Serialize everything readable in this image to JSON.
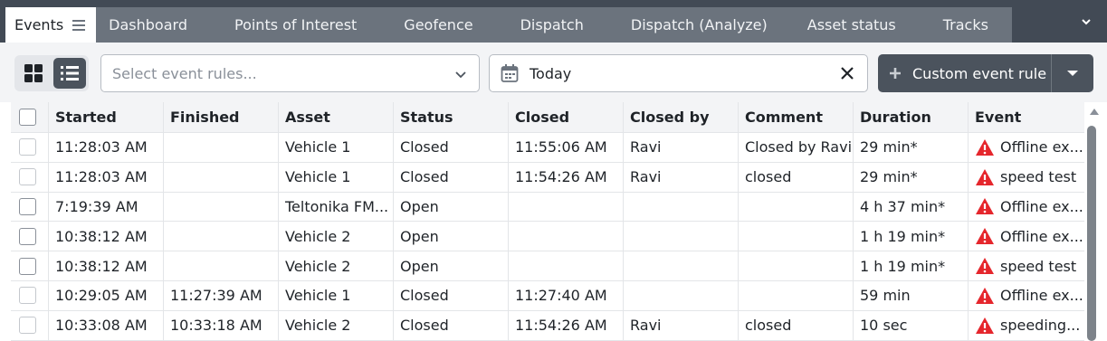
{
  "tabs": [
    {
      "label": "Events",
      "active": true
    },
    {
      "label": "Dashboard"
    },
    {
      "label": "Points of Interest"
    },
    {
      "label": "Geofence"
    },
    {
      "label": "Dispatch"
    },
    {
      "label": "Dispatch (Analyze)"
    },
    {
      "label": "Asset status"
    },
    {
      "label": "Tracks"
    }
  ],
  "toolbar": {
    "rules_placeholder": "Select event rules...",
    "date_value": "Today",
    "custom_rule_label": "Custom event rule"
  },
  "table": {
    "columns": [
      "Started",
      "Finished",
      "Asset",
      "Status",
      "Closed",
      "Closed by",
      "Comment",
      "Duration",
      "Event"
    ],
    "rows": [
      {
        "started": "11:28:03 AM",
        "finished": "",
        "asset": "Vehicle 1",
        "status": "Closed",
        "closed": "11:55:06 AM",
        "closed_by": "Ravi",
        "comment": "Closed by Ravi",
        "duration": "29 min*",
        "event": "Offline ex..."
      },
      {
        "started": "11:28:03 AM",
        "finished": "",
        "asset": "Vehicle 1",
        "status": "Closed",
        "closed": "11:54:26 AM",
        "closed_by": "Ravi",
        "comment": "closed",
        "duration": "29 min*",
        "event": "speed test"
      },
      {
        "started": "7:19:39 AM",
        "finished": "",
        "asset": "Teltonika FM...",
        "status": "Open",
        "closed": "",
        "closed_by": "",
        "comment": "",
        "duration": "4 h 37 min*",
        "event": "Offline ex..."
      },
      {
        "started": "10:38:12 AM",
        "finished": "",
        "asset": "Vehicle 2",
        "status": "Open",
        "closed": "",
        "closed_by": "",
        "comment": "",
        "duration": "1 h 19 min*",
        "event": "Offline ex..."
      },
      {
        "started": "10:38:12 AM",
        "finished": "",
        "asset": "Vehicle 2",
        "status": "Open",
        "closed": "",
        "closed_by": "",
        "comment": "",
        "duration": "1 h 19 min*",
        "event": "speed test"
      },
      {
        "started": "10:29:05 AM",
        "finished": "11:27:39 AM",
        "asset": "Vehicle 1",
        "status": "Closed",
        "closed": "11:27:40 AM",
        "closed_by": "",
        "comment": "",
        "duration": "59 min",
        "event": "Offline ex..."
      },
      {
        "started": "10:33:08 AM",
        "finished": "10:33:18 AM",
        "asset": "Vehicle 2",
        "status": "Closed",
        "closed": "11:54:26 AM",
        "closed_by": "Ravi",
        "comment": "closed",
        "duration": "10 sec",
        "event": "speeding..."
      }
    ]
  },
  "colors": {
    "tab_strip": "#424a55",
    "tab_inactive": "#6b737d",
    "primary_button": "#4b535d",
    "warning_red": "#e5262c"
  },
  "icons": {
    "menu": "hamburger-icon",
    "tabs_overflow": "chevron-down-icon",
    "grid_view": "grid-icon",
    "list_view": "list-icon",
    "select_caret": "chevron-down-icon",
    "calendar": "calendar-icon",
    "clear": "close-icon",
    "add": "plus-icon",
    "event": "warning-triangle-icon"
  }
}
